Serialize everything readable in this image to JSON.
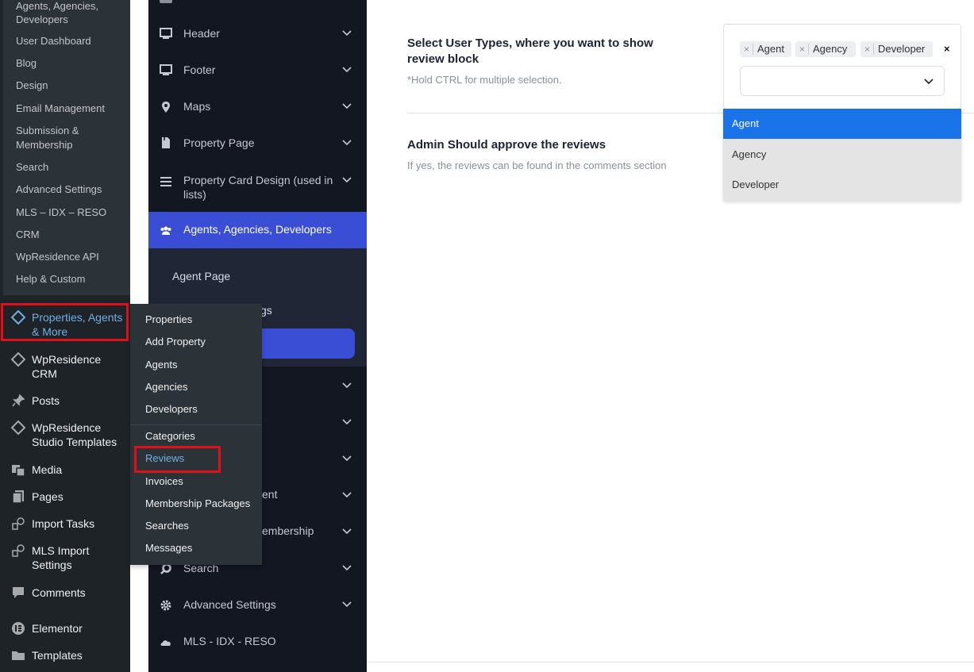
{
  "wp_submenu_top": [
    "Agents, Agencies,",
    "Developers",
    "User Dashboard",
    "Blog",
    "Design",
    "Email Management",
    "Submission &",
    "Membership",
    "Search",
    "Advanced Settings",
    "MLS – IDX – RESO",
    "CRM",
    "WpResidence API",
    "Help & Custom"
  ],
  "wp_menu": {
    "properties_l1": "Properties, Agents",
    "properties_l2": "& More",
    "crm_l1": "WpResidence",
    "crm_l2": "CRM",
    "posts": "Posts",
    "studio_l1": "WpResidence",
    "studio_l2": "Studio Templates",
    "media": "Media",
    "pages": "Pages",
    "import_tasks": "Import Tasks",
    "mls_l1": "MLS Import",
    "mls_l2": "Settings",
    "comments": "Comments",
    "elementor": "Elementor",
    "templates": "Templates"
  },
  "flyout": [
    "Properties",
    "Add Property",
    "Agents",
    "Agencies",
    "Developers",
    "Categories",
    "Reviews",
    "Invoices",
    "Membership Packages",
    "Searches",
    "Messages"
  ],
  "options_panel": {
    "header": "Header",
    "footer": "Footer",
    "maps": "Maps",
    "property_page": "Property Page",
    "property_card_l1": "Property Card Design (used in",
    "property_card_l2": "lists)",
    "agents": "Agents, Agencies, Developers",
    "agent_page": "Agent Page",
    "partial_gs": "gs",
    "partial_ent": "ent",
    "partial_membership": "embership",
    "search": "Search",
    "advanced": "Advanced Settings",
    "mls": "MLS - IDX - RESO"
  },
  "main": {
    "user_types_title_l1": "Select User Types, where you want to show",
    "user_types_title_l2": "review block",
    "user_types_desc": "*Hold CTRL for multiple selection.",
    "approve_title": "Admin Should approve the reviews",
    "approve_desc": "If yes, the reviews can be found in the comments section",
    "selected_tags": [
      "Agent",
      "Agency",
      "Developer"
    ],
    "tag_remove": "×",
    "clear_all": "×",
    "dropdown_options": [
      "Agent",
      "Agency",
      "Developer"
    ]
  },
  "colors": {
    "accent": "#3a4ed5",
    "highlight": "#1a73e8",
    "annotation": "#e0101a"
  }
}
